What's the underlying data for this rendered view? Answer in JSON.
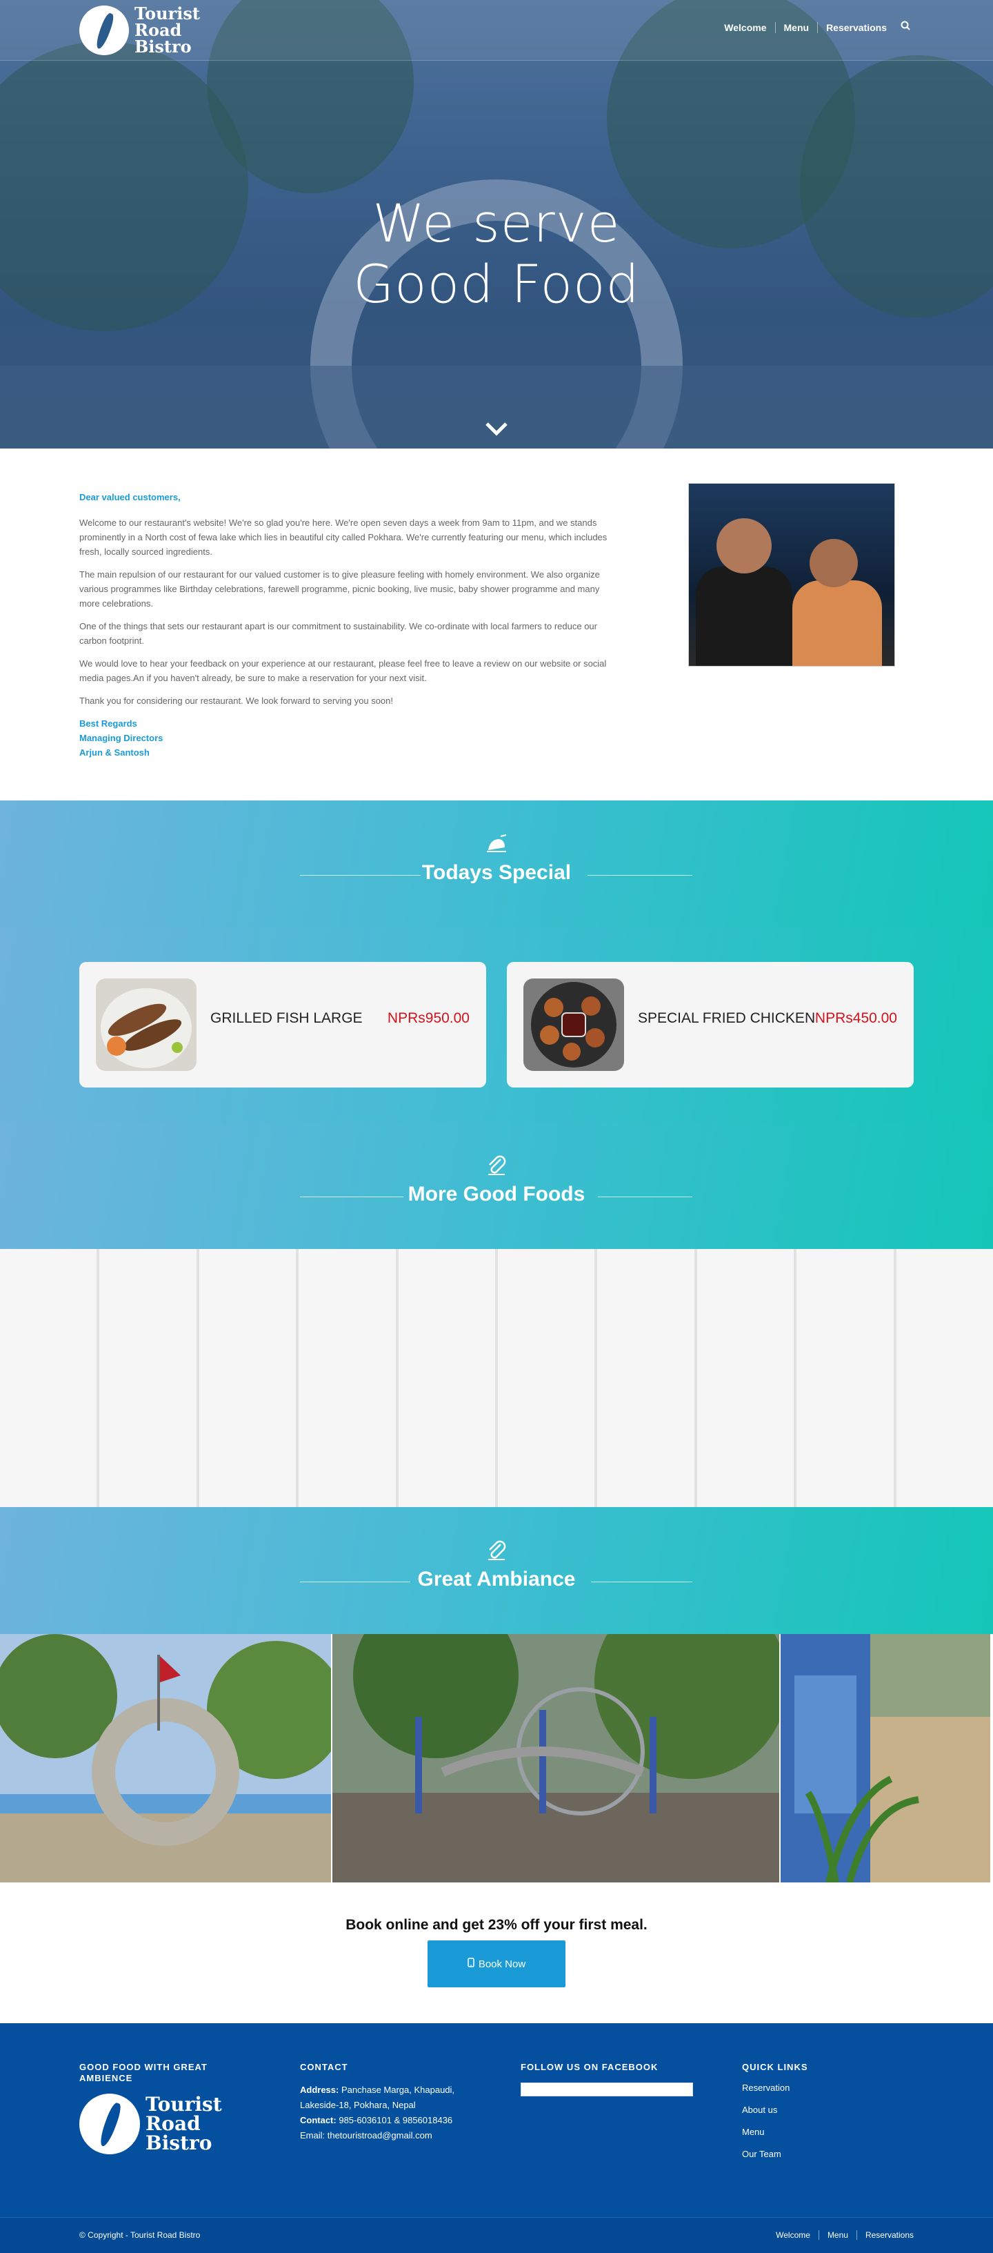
{
  "brand": {
    "name_line1": "Tourist",
    "name_line2": "Road",
    "name_line3": "Bistro"
  },
  "nav": {
    "items": [
      "Welcome",
      "Menu",
      "Reservations"
    ]
  },
  "hero": {
    "title_line1": "We serve",
    "title_line2": "Good Food"
  },
  "intro": {
    "greeting": "Dear valued customers,",
    "paragraphs": [
      "Welcome to our restaurant's website! We're so glad you're here. We're open seven days a week from 9am to 11pm, and we stands prominently in a North cost of fewa lake which lies in beautiful city called Pokhara. We're currently featuring our menu, which includes fresh, locally sourced ingredients.",
      "The main repulsion of our restaurant for our valued customer is to give pleasure feeling with homely environment. We also organize various programmes like Birthday celebrations, farewell programme, picnic booking, live music, baby shower programme and many more celebrations.",
      "One of the things that sets our restaurant apart is our commitment to sustainability. We co-ordinate with local farmers to reduce our carbon footprint.",
      "We would love to hear your feedback on your experience at our restaurant, please feel free to leave a review on our website or social media pages.An if you haven't already, be sure to make a reservation for your next visit.",
      "Thank you for considering our restaurant. We look forward to serving you soon!"
    ],
    "signature": [
      "Best Regards",
      "Managing Directors",
      "Arjun & Santosh"
    ]
  },
  "sections": {
    "specials_title": "Todays Special",
    "more_title": "More Good Foods",
    "ambiance_title": "Great Ambiance"
  },
  "specials": [
    {
      "name": "GRILLED FISH LARGE",
      "price": "NPRs950.00"
    },
    {
      "name": "SPECIAL FRIED CHICKEN",
      "price": "NPRs450.00"
    }
  ],
  "book": {
    "headline": "Book online and get 23% off your first meal.",
    "button_label": "Book Now",
    "button_icon": "mobile-phone-icon"
  },
  "footer": {
    "col1_title": "GOOD FOOD WITH GREAT AMBIENCE",
    "contact_title": "CONTACT",
    "address_label": "Address:",
    "address_line1": "Panchase Marga, Khapaudi,",
    "address_line2": "Lakeside-18, Pokhara, Nepal",
    "contact_label": "Contact:",
    "contact_value": "985-6036101 & 9856018436",
    "email": "Email: thetouristroad@gmail.com",
    "facebook_title": "FOLLOW US ON FACEBOOK",
    "quick_title": "QUICK LINKS",
    "quick_links": [
      "Reservation",
      "About us",
      "Menu",
      "Our Team"
    ]
  },
  "copyright": {
    "text": "© Copyright - Tourist Road Bistro",
    "links": [
      "Welcome",
      "Menu",
      "Reservations"
    ]
  },
  "colors": {
    "accent": "#1a9bd7",
    "footer": "#04509f",
    "price": "#d2131c",
    "band_start": "#6eb4df",
    "band_end": "#14c6b8"
  }
}
